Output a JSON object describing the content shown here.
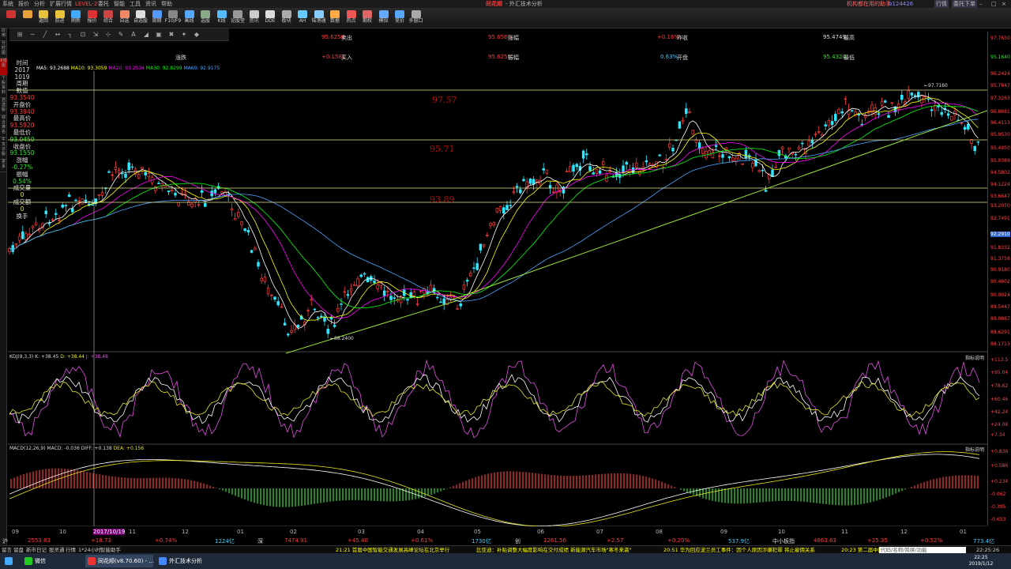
{
  "menu": {
    "items": [
      "系统",
      "报价",
      "分析",
      "扩展行情",
      "LEVEL-2",
      "委托",
      "智能",
      "工具",
      "资讯",
      "帮助"
    ],
    "title": "同花顺",
    "subtitle": "- 外汇技术分析",
    "right_link": "机构都在用的助手",
    "right_code": "b124426",
    "right_btns": [
      "行情",
      "委托下单"
    ]
  },
  "toolbar": {
    "items": [
      "",
      "",
      "返回",
      "前进",
      "刷新",
      "报价",
      "综合",
      "自选",
      "自选股",
      "周期",
      "F10/F9",
      "画线",
      "选股",
      "K线",
      "论股堂",
      "资讯",
      "DDE",
      "板块",
      "AH",
      "陆港通",
      "数据",
      "热点",
      "期权",
      "模拟",
      "竞价",
      "多窗口"
    ]
  },
  "leftstrip": [
    "应用",
    "分时图",
    "K线图",
    "个股资料",
    "自选股",
    "综合排名",
    "牛叉诊股",
    "更多"
  ],
  "info": {
    "labels": [
      "时间",
      "周期",
      "数值",
      "开盘价",
      "最高价",
      "最低价",
      "收盘价",
      "涨幅",
      "振幅",
      "成交量",
      "成交额",
      "换手"
    ],
    "time": "2017",
    "date": "1019",
    "open": "93.3540",
    "high": "93.3940",
    "low": "93.5920",
    "close": "93.0450",
    "close2": "93.1550",
    "change": "-0.27%",
    "amp": "0.54%",
    "vol": "0",
    "amt": "0"
  },
  "quotes": [
    {
      "v": "95.6250",
      "l": "卖出"
    },
    {
      "v": "95.6560",
      "l": "涨幅"
    },
    {
      "v": "+0.16%",
      "l": "昨收"
    },
    {
      "v": "95.4749",
      "l": "最高"
    },
    {
      "v": "+0.1581",
      "l": "买入"
    },
    {
      "v": "95.6250",
      "l": "振幅"
    },
    {
      "v": "0.63%",
      "l": "开盘"
    },
    {
      "v": "95.4320",
      "l": "最低"
    }
  ],
  "chg_label": "涨跌",
  "ma_line": {
    "ma5": "MA5: 93.2688",
    "ma10": "MA10: 93.3059",
    "ma20": "MA20: 93.2534",
    "ma30": "MA30: 92.8299",
    "ma60": "MA60: 92.9175"
  },
  "hlines": [
    {
      "price": "97.57"
    },
    {
      "price": "95.71"
    },
    {
      "price": "93.89"
    }
  ],
  "peak_label": "97.7160",
  "low_label": "88.2400",
  "price_axis": [
    "97.7650",
    "95.1640",
    "96.2424",
    "95.7847",
    "97.3263",
    "96.8681",
    "96.4113",
    "95.9530",
    "95.4950",
    "95.0389",
    "94.5802",
    "94.1224",
    "93.6647",
    "93.2070",
    "92.7491",
    "92.2910",
    "91.8332",
    "91.3758",
    "90.9180",
    "90.4602",
    "90.0024",
    "89.5447",
    "89.0867",
    "88.6291",
    "88.1713"
  ],
  "kdj": {
    "title": "KDJ(9,3,3)",
    "k": "K: +38.45",
    "d": "D: +38.44",
    "j": "J: +38.48",
    "axis": [
      "+113.5",
      "+95.04",
      "+78.62",
      "+60.46",
      "+42.24",
      "+24.08",
      "+7.34"
    ],
    "help": "指标说明"
  },
  "macd": {
    "title": "MACD(12,26,9)",
    "macd": "MACD: -0.036",
    "diff": "DIFF: +0.138",
    "dea": "DEA: +0.156",
    "axis": [
      "+0.836",
      "+0.586",
      "+0.234",
      "-0.062",
      "-0.395",
      "-0.653"
    ],
    "help": "指标说明"
  },
  "months": [
    "09",
    "10",
    "2017/10/19",
    "11",
    "12",
    "01",
    "02",
    "03",
    "04",
    "05",
    "06",
    "07",
    "08",
    "09",
    "10",
    "11",
    "12",
    "01"
  ],
  "bottom": {
    "sh": "沪",
    "shv": "2553.83",
    "shc": "+18.73",
    "shp": "+0.74%",
    "sht": "1224亿",
    "sz": "深",
    "szv": "7474.91",
    "szc": "+45.40",
    "szp": "+0.61%",
    "szt": "1730亿",
    "cy": "创",
    "cyv": "1261.56",
    "cyc": "+2.57",
    "cyp": "+0.20%",
    "cyt": "537.9亿",
    "zx": "中小板指",
    "zxv": "4863.63",
    "zxc": "+25.35",
    "zxp": "+0.52%",
    "zxt": "773.4亿"
  },
  "status": {
    "items": [
      "留言",
      "留盘",
      "新市日记",
      "股灵通",
      "行情",
      "1*24小时",
      "智能助手"
    ],
    "news1": "21:21 首届中国智能交通发展高峰论坛在北京举行",
    "news2": "比亚迪：补贴调整大幅度影响在交付成绩 新能源汽车市场\"寒冬来袭\"",
    "news3": "20:51 华为回应波兰员工事件：因个人原因涉嫌犯罪 将止雇佣关系",
    "news4": "20:23 第二届中国国际进口",
    "search": "代码/名称/简拼/功能",
    "clock": "22:25:26"
  },
  "taskbar": {
    "items": [
      "微信",
      "同花顺(v8.70.60) - ...",
      "外汇技术分析"
    ],
    "time": "22:25",
    "date": "2019/1/12"
  },
  "colors": {
    "up": "#ff3b3b",
    "down": "#2ee8ff",
    "ma5": "#ffffff",
    "ma10": "#ffff00",
    "ma20": "#ff00ff",
    "ma30": "#00ff00",
    "ma60": "#4da6ff"
  }
}
